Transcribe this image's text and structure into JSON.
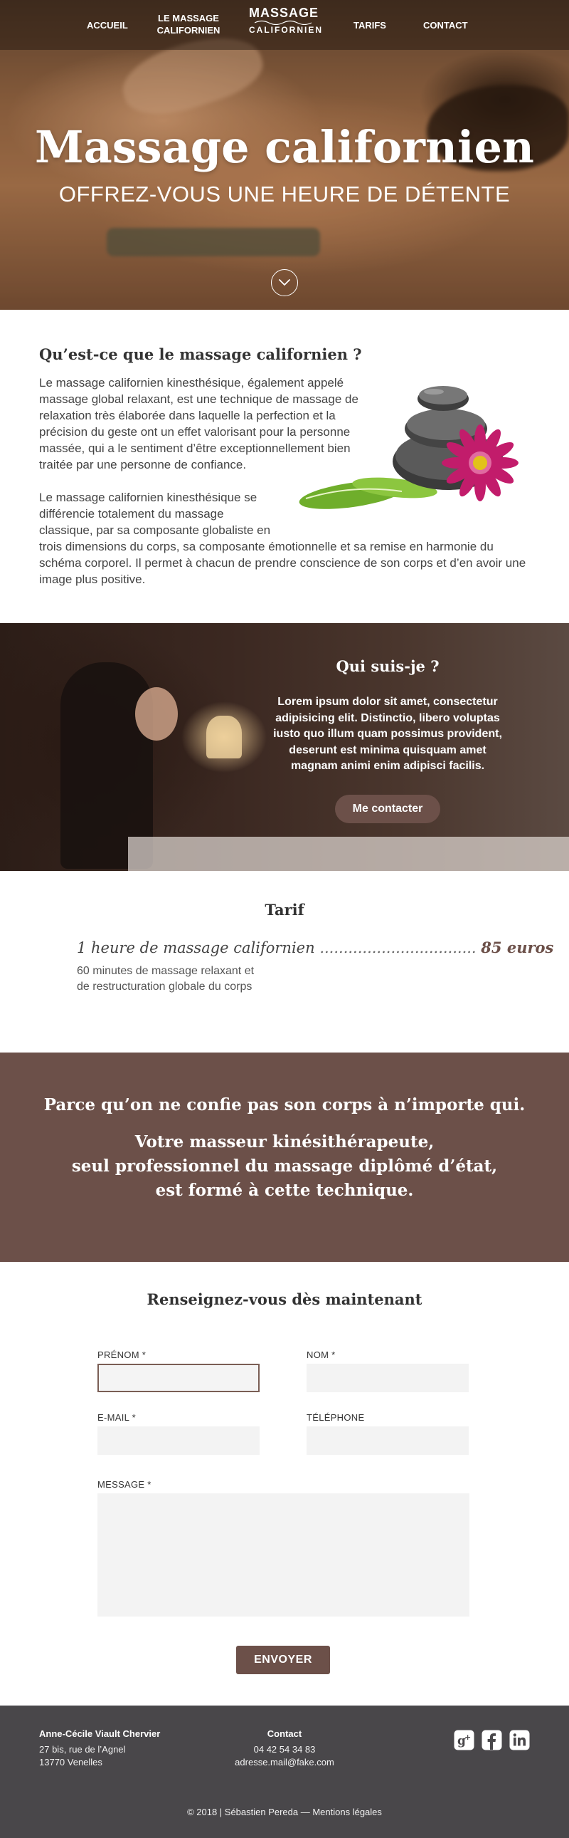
{
  "nav": {
    "accueil": "ACCUEIL",
    "le_massage": "LE MASSAGE CALIFORNIEN",
    "logo_line1": "MASSAGE",
    "logo_line2": "californien",
    "tarifs": "TARIFS",
    "contact": "CONTACT"
  },
  "hero": {
    "title": "Massage californien",
    "subtitle": "OFFREZ-VOUS UNE HEURE DE DÉTENTE"
  },
  "about": {
    "title": "Qu’est-ce que le massage californien ?",
    "paragraph1": "Le massage californien kinesthésique, également appelé massage global relaxant, est une technique de massage de relaxation très élaborée dans laquelle la perfection et la précision du geste ont un effet valorisant pour la personne massée, qui a le sentiment d’être exceptionnellement bien traitée par une personne de confiance.",
    "paragraph2a": "Le massage californien kinesthésique se différencie totalement du massage classique, par sa composante globaliste en",
    "paragraph2b": "trois dimensions du corps, sa composante émotionnelle et sa remise en harmonie du schéma corporel. Il permet à chacun de prendre conscience de son corps et d’en avoir une image plus positive."
  },
  "who": {
    "title": "Qui suis-je ?",
    "text": "Lorem ipsum dolor sit amet, consectetur adipisicing elit. Distinctio, libero voluptas iusto quo illum quam possimus provident, deserunt est minima quisquam amet magnam animi enim adipisci facilis.",
    "button": "Me contacter"
  },
  "tarif": {
    "title": "Tarif",
    "item": "1 heure de massage californien",
    "dots": ".................................",
    "price": "85 euros",
    "desc_line1": "60 minutes de massage relaxant et",
    "desc_line2": "de restructuration globale du corps"
  },
  "quote": {
    "line1": "Parce qu’on ne confie pas son corps à n’importe qui.",
    "line2": "Votre masseur kinésithérapeute,",
    "line3": "seul professionnel du massage diplômé d’état,",
    "line4": "est formé à cette technique."
  },
  "form": {
    "title": "Renseignez-vous dès maintenant",
    "prenom_label": "PRÉNOM *",
    "prenom_value": "",
    "nom_label": "NOM *",
    "nom_value": "",
    "email_label": "E-MAIL *",
    "email_value": "",
    "telephone_label": "TÉLÉPHONE",
    "telephone_value": "",
    "message_label": "MESSAGE *",
    "message_value": "",
    "submit": "ENVOYER"
  },
  "footer": {
    "name": "Anne-Cécile Viault Chervier",
    "address1": "27 bis, rue de l’Agnel",
    "address2": "13770 Venelles",
    "contact_title": "Contact",
    "phone": "04 42 54 34 83",
    "email": "adresse.mail@fake.com",
    "copyright": "© 2018 | Sébastien Pereda — Mentions légales",
    "social_icons": [
      "google-plus-icon",
      "facebook-icon",
      "linkedin-icon"
    ]
  },
  "colors": {
    "accent": "#6c5049",
    "footer_bg": "#49474a",
    "text": "#333333"
  }
}
